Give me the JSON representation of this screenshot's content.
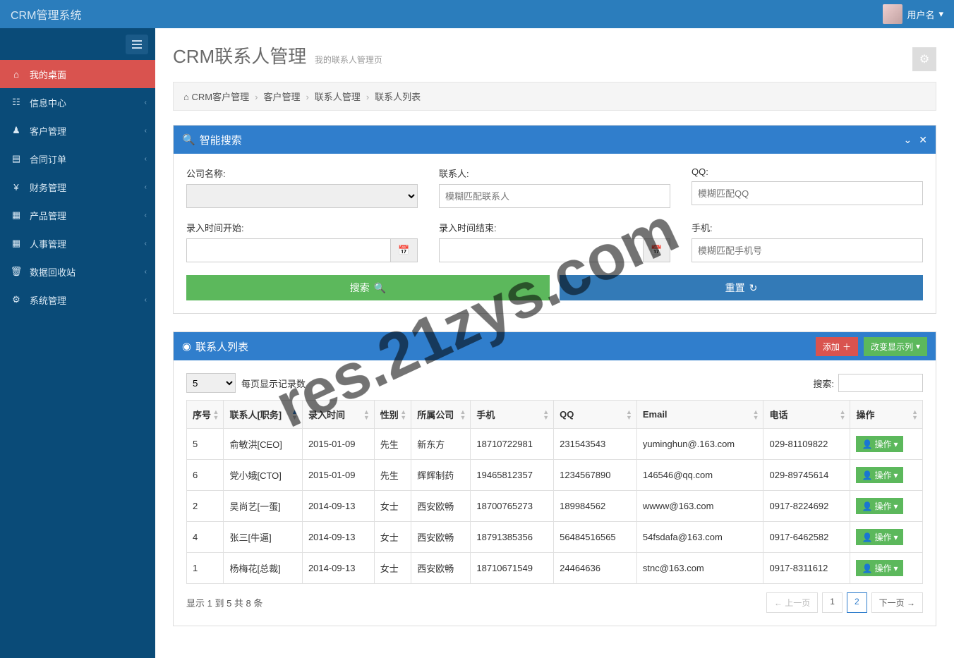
{
  "brand": "CRM管理系统",
  "user": {
    "name": "用户名"
  },
  "watermark": "res.21zys.com",
  "sidebar": {
    "items": [
      {
        "icon": "⌂",
        "label": "我的桌面",
        "active": true,
        "expandable": false
      },
      {
        "icon": "☷",
        "label": "信息中心",
        "active": false,
        "expandable": true
      },
      {
        "icon": "♟",
        "label": "客户管理",
        "active": false,
        "expandable": true
      },
      {
        "icon": "▤",
        "label": "合同订单",
        "active": false,
        "expandable": true
      },
      {
        "icon": "¥",
        "label": "财务管理",
        "active": false,
        "expandable": true
      },
      {
        "icon": "▦",
        "label": "产品管理",
        "active": false,
        "expandable": true
      },
      {
        "icon": "▦",
        "label": "人事管理",
        "active": false,
        "expandable": true
      },
      {
        "icon": "🗑",
        "label": "数据回收站",
        "active": false,
        "expandable": true
      },
      {
        "icon": "⚙",
        "label": "系统管理",
        "active": false,
        "expandable": true
      }
    ]
  },
  "page": {
    "title": "CRM联系人管理",
    "subtitle": "我的联系人管理页"
  },
  "breadcrumb": [
    "CRM客户管理",
    "客户管理",
    "联系人管理",
    "联系人列表"
  ],
  "search_panel": {
    "title": "智能搜索",
    "fields": {
      "company": {
        "label": "公司名称:"
      },
      "contact": {
        "label": "联系人:",
        "placeholder": "模糊匹配联系人"
      },
      "qq": {
        "label": "QQ:",
        "placeholder": "模糊匹配QQ"
      },
      "start": {
        "label": "录入时间开始:"
      },
      "end": {
        "label": "录入时间结束:"
      },
      "mobile": {
        "label": "手机:",
        "placeholder": "模糊匹配手机号"
      }
    },
    "btn_search": "搜索",
    "btn_reset": "重置"
  },
  "list_panel": {
    "title": "联系人列表",
    "btn_add": "添加",
    "btn_cols": "改变显示列",
    "page_size": "5",
    "page_size_label": "每页显示记录数",
    "search_label": "搜索:",
    "columns": [
      "序号",
      "联系人[职务]",
      "录入时间",
      "性别",
      "所属公司",
      "手机",
      "QQ",
      "Email",
      "电话",
      "操作"
    ],
    "op_label": "操作",
    "rows": [
      {
        "no": "5",
        "name": "俞敏洪[CEO]",
        "date": "2015-01-09",
        "sex": "先生",
        "company": "新东方",
        "mobile": "18710722981",
        "qq": "231543543",
        "email": "yuminghun@.163.com",
        "tel": "029-81109822"
      },
      {
        "no": "6",
        "name": "党小娥[CTO]",
        "date": "2015-01-09",
        "sex": "先生",
        "company": "辉辉制药",
        "mobile": "19465812357",
        "qq": "1234567890",
        "email": "146546@qq.com",
        "tel": "029-89745614"
      },
      {
        "no": "2",
        "name": "吴尚艺[一蛋]",
        "date": "2014-09-13",
        "sex": "女士",
        "company": "西安欧畅",
        "mobile": "18700765273",
        "qq": "189984562",
        "email": "wwww@163.com",
        "tel": "0917-8224692"
      },
      {
        "no": "4",
        "name": "张三[牛逼]",
        "date": "2014-09-13",
        "sex": "女士",
        "company": "西安欧畅",
        "mobile": "18791385356",
        "qq": "56484516565",
        "email": "54fsdafa@163.com",
        "tel": "0917-6462582"
      },
      {
        "no": "1",
        "name": "杨梅花[总裁]",
        "date": "2014-09-13",
        "sex": "女士",
        "company": "西安欧畅",
        "mobile": "18710671549",
        "qq": "24464636",
        "email": "stnc@163.com",
        "tel": "0917-8311612"
      }
    ],
    "footer_info": "显示 1 到 5 共 8 条",
    "pager": {
      "prev": "← 上一页",
      "pages": [
        "1",
        "2"
      ],
      "next": "下一页 →",
      "active": "2"
    }
  }
}
